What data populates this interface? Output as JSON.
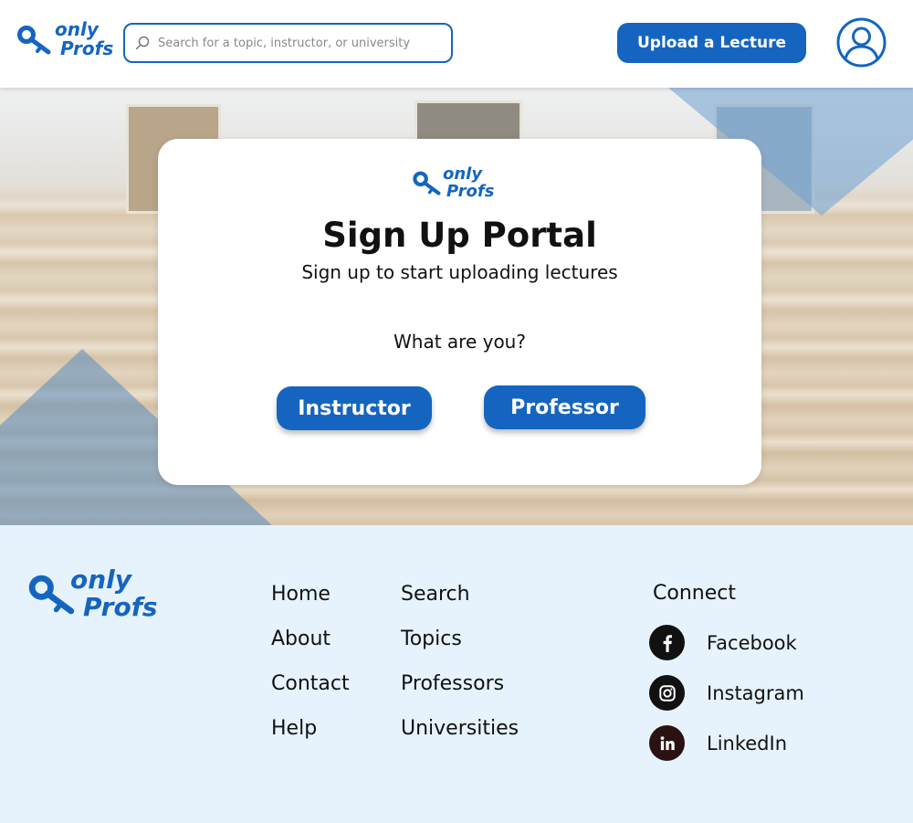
{
  "header": {
    "logo": {
      "line1": "only",
      "line2": "Profs"
    },
    "search": {
      "placeholder": "Search for a topic, instructor, or university"
    },
    "upload_label": "Upload a Lecture"
  },
  "card": {
    "logo": {
      "line1": "only",
      "line2": "Profs"
    },
    "title": "Sign Up Portal",
    "subtitle": "Sign up to start uploading lectures",
    "question": "What are you?",
    "buttons": {
      "instructor": "Instructor",
      "professor": "Professor"
    }
  },
  "footer": {
    "logo": {
      "line1": "only",
      "line2": "Profs"
    },
    "col1": [
      "Home",
      "About",
      "Contact",
      "Help"
    ],
    "col2": [
      "Search",
      "Topics",
      "Professors",
      "Universities"
    ],
    "connect_title": "Connect",
    "social": [
      {
        "label": "Facebook",
        "icon": "facebook-icon"
      },
      {
        "label": "Instagram",
        "icon": "instagram-icon"
      },
      {
        "label": "LinkedIn",
        "icon": "linkedin-icon"
      }
    ]
  },
  "colors": {
    "brand": "#1565c0",
    "footer_bg": "#e6f3fc",
    "icon_dark": "#111111"
  }
}
